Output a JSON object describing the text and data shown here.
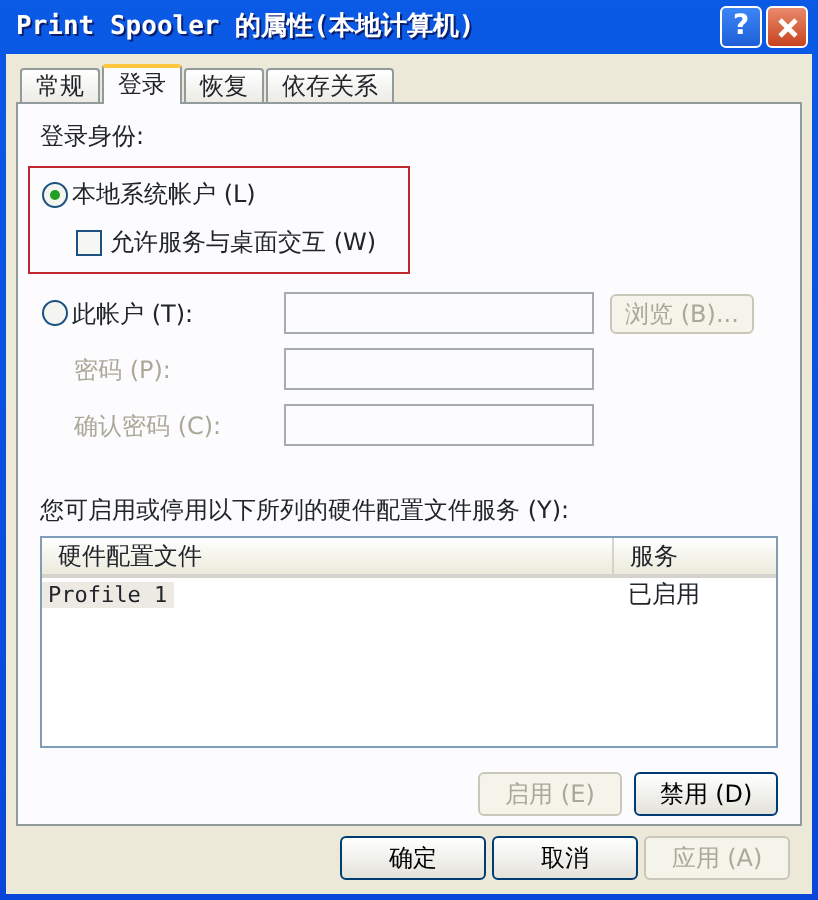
{
  "window": {
    "title": "Print Spooler 的属性(本地计算机)",
    "help_button": "?"
  },
  "tabs": [
    {
      "label": "常规",
      "selected": false
    },
    {
      "label": "登录",
      "selected": true
    },
    {
      "label": "恢复",
      "selected": false
    },
    {
      "label": "依存关系",
      "selected": false
    }
  ],
  "logon": {
    "label": "登录身份:",
    "highlighted": true,
    "local_system": {
      "label": "本地系统帐户 (L)",
      "selected": true
    },
    "interact": {
      "label": "允许服务与桌面交互 (W)",
      "checked": false
    },
    "this_account": {
      "label": "此帐户 (T):",
      "selected": false
    },
    "browse_button": {
      "label": "浏览 (B)...",
      "disabled": true
    },
    "password": {
      "label": "密码 (P):",
      "disabled": true
    },
    "confirm_password": {
      "label": "确认密码 (C):",
      "disabled": true
    }
  },
  "hardware": {
    "label": "您可启用或停用以下所列的硬件配置文件服务 (Y):",
    "columns": [
      "硬件配置文件",
      "服务"
    ],
    "rows": [
      {
        "cells": [
          "Profile 1",
          "已启用"
        ]
      }
    ],
    "buttons": [
      {
        "label": "启用 (E)",
        "disabled": true
      },
      {
        "label": "禁用 (D)",
        "disabled": false
      }
    ]
  },
  "footer_buttons": [
    {
      "label": "确定",
      "disabled": false
    },
    {
      "label": "取消",
      "disabled": false
    },
    {
      "label": "应用 (A)",
      "disabled": true
    }
  ]
}
